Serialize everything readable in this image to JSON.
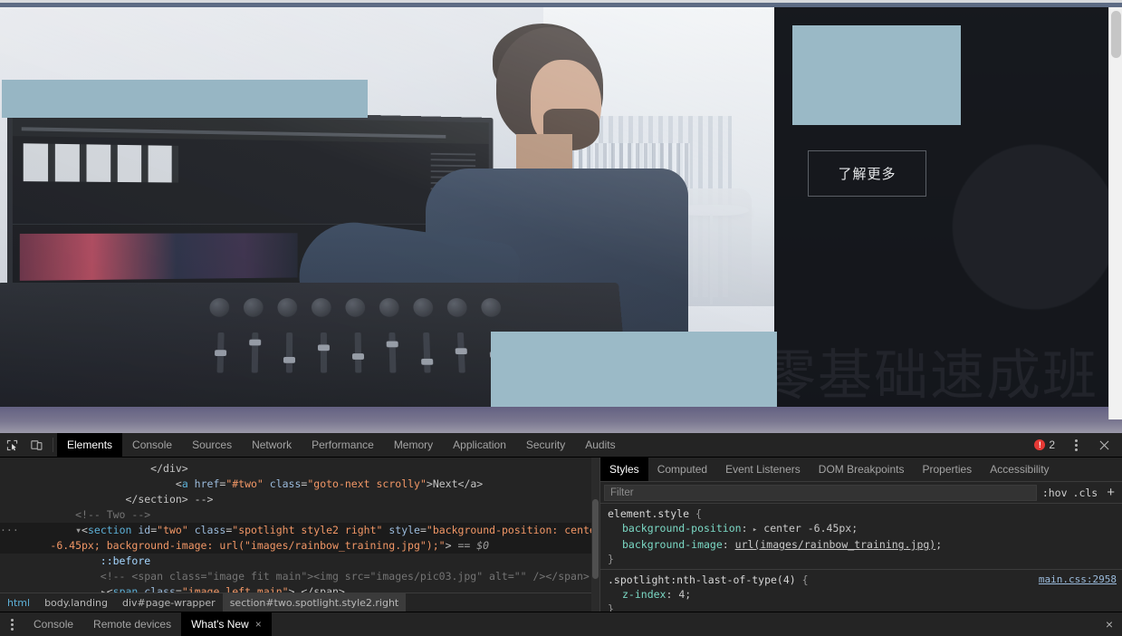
{
  "webpage": {
    "spotlight": {
      "background_text": "零基础速成班",
      "learn_more_label": "了解更多",
      "heading_block_color": "#9ab9c6"
    },
    "blocks": {
      "top_block_color": "#97b6c4",
      "bottom_block_color": "#9bbac7"
    }
  },
  "devtools": {
    "toolbar": {
      "icons": [
        {
          "name": "inspect-element-icon",
          "title": "Inspect"
        },
        {
          "name": "device-toolbar-icon",
          "title": "Toggle device toolbar"
        }
      ],
      "tabs": [
        {
          "label": "Elements",
          "active": true
        },
        {
          "label": "Console",
          "active": false
        },
        {
          "label": "Sources",
          "active": false
        },
        {
          "label": "Network",
          "active": false
        },
        {
          "label": "Performance",
          "active": false
        },
        {
          "label": "Memory",
          "active": false
        },
        {
          "label": "Application",
          "active": false
        },
        {
          "label": "Security",
          "active": false
        },
        {
          "label": "Audits",
          "active": false
        }
      ],
      "error_count": "2",
      "error_color": "#e53935"
    },
    "elements_tree": {
      "rows": [
        {
          "indent": 5,
          "segments": [
            {
              "text": "</div>",
              "cls": "punct"
            }
          ]
        },
        {
          "indent": 6,
          "segments": [
            {
              "text": "<",
              "cls": "punct"
            },
            {
              "text": "a",
              "cls": "tag"
            },
            {
              "text": " href",
              "cls": "attr"
            },
            {
              "text": "=",
              "cls": "punct"
            },
            {
              "text": "\"#two\"",
              "cls": "val"
            },
            {
              "text": " class",
              "cls": "attr"
            },
            {
              "text": "=",
              "cls": "punct"
            },
            {
              "text": "\"goto-next scrolly\"",
              "cls": "val"
            },
            {
              "text": ">Next</a>",
              "cls": "punct"
            }
          ]
        },
        {
          "indent": 4,
          "segments": [
            {
              "text": "</section> -->",
              "cls": "punct"
            }
          ]
        },
        {
          "indent": 2,
          "segments": [
            {
              "text": "<!-- Two -->",
              "cls": "comment"
            }
          ]
        },
        {
          "indent": 2,
          "selected": true,
          "gutter": "···",
          "triangle": true,
          "segments": [
            {
              "text": "<",
              "cls": "punct"
            },
            {
              "text": "section",
              "cls": "tag"
            },
            {
              "text": " id",
              "cls": "attr"
            },
            {
              "text": "=",
              "cls": "punct"
            },
            {
              "text": "\"two\"",
              "cls": "val"
            },
            {
              "text": " class",
              "cls": "attr"
            },
            {
              "text": "=",
              "cls": "punct"
            },
            {
              "text": "\"spotlight style2 right\"",
              "cls": "val"
            },
            {
              "text": " style",
              "cls": "attr"
            },
            {
              "text": "=",
              "cls": "punct"
            },
            {
              "text": "\"background-position: center",
              "cls": "val"
            }
          ]
        },
        {
          "indent": 1,
          "selected": true,
          "segments": [
            {
              "text": "-6.45px; background-image: url(\"images/rainbow_training.jpg\");\"",
              "cls": "val"
            },
            {
              "text": "> ",
              "cls": "punct"
            },
            {
              "text": "== $0",
              "cls": "eq0"
            }
          ]
        },
        {
          "indent": 3,
          "segments": [
            {
              "text": "::before",
              "cls": "pseudo"
            }
          ]
        },
        {
          "indent": 3,
          "segments": [
            {
              "text": "<!-- <span class=\"image fit main\"><img src=\"images/pic03.jpg\" alt=\"\" /></span> -->",
              "cls": "comment"
            }
          ]
        },
        {
          "indent": 3,
          "triangle_right": true,
          "segments": [
            {
              "text": "<",
              "cls": "punct"
            },
            {
              "text": "span",
              "cls": "tag"
            },
            {
              "text": " class",
              "cls": "attr"
            },
            {
              "text": "=",
              "cls": "punct"
            },
            {
              "text": "\"image left main\"",
              "cls": "val"
            },
            {
              "text": "> </span>",
              "cls": "punct"
            }
          ]
        }
      ]
    },
    "breadcrumb": [
      {
        "text": "html",
        "type": "tag",
        "active": false
      },
      {
        "text": "body.landing",
        "type": "mixed",
        "active": false
      },
      {
        "text": "div#page-wrapper",
        "type": "mixed",
        "active": false
      },
      {
        "text": "section#two.spotlight.style2.right",
        "type": "mixed",
        "active": true
      }
    ],
    "styles_panel": {
      "tabs": [
        {
          "label": "Styles",
          "active": true
        },
        {
          "label": "Computed",
          "active": false
        },
        {
          "label": "Event Listeners",
          "active": false
        },
        {
          "label": "DOM Breakpoints",
          "active": false
        },
        {
          "label": "Properties",
          "active": false
        },
        {
          "label": "Accessibility",
          "active": false
        }
      ],
      "filter_placeholder": "Filter",
      "filter_value": "",
      "hov_label": ":hov",
      "cls_label": ".cls",
      "new_rule_label": "+",
      "rules": [
        {
          "selector": "element.style",
          "source": "",
          "declarations": [
            {
              "name": "background-position",
              "value": "center -6.45px",
              "has_disclosure": true
            },
            {
              "name": "background-image",
              "value": "url(images/rainbow_training.jpg)",
              "underline": "images/rainbow_training.jpg"
            }
          ]
        },
        {
          "selector": ".spotlight:nth-last-of-type(4)",
          "source": "main.css:2958",
          "declarations": [
            {
              "name": "z-index",
              "value": "4"
            }
          ]
        }
      ]
    },
    "drawer": {
      "tabs": [
        {
          "label": "Console",
          "active": false,
          "closable": false
        },
        {
          "label": "Remote devices",
          "active": false,
          "closable": false
        },
        {
          "label": "What's New",
          "active": true,
          "closable": true
        }
      ],
      "close_label": "×"
    }
  }
}
